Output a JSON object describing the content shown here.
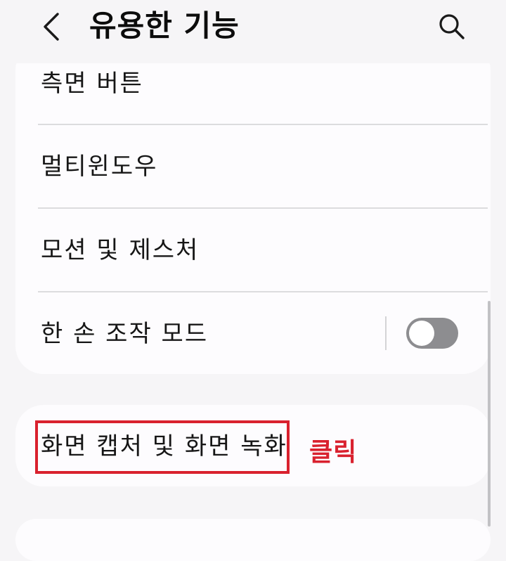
{
  "header": {
    "title": "유용한 기능",
    "back_icon": "chevron-left-icon",
    "search_icon": "search-icon"
  },
  "settings_group": {
    "items": [
      {
        "label": "측면 버튼"
      },
      {
        "label": "멀티윈도우"
      },
      {
        "label": "모션 및 제스처"
      },
      {
        "label": "한 손 조작 모드",
        "toggle": "off"
      }
    ]
  },
  "capture_group": {
    "items": [
      {
        "label": "화면 캡처 및 화면 녹화"
      }
    ]
  },
  "annotation": {
    "click_label": "클릭",
    "color": "#d9212e"
  },
  "colors": {
    "background": "#f6f5f7",
    "card": "#fdfcfe",
    "toggle_off": "#8d8d90"
  }
}
